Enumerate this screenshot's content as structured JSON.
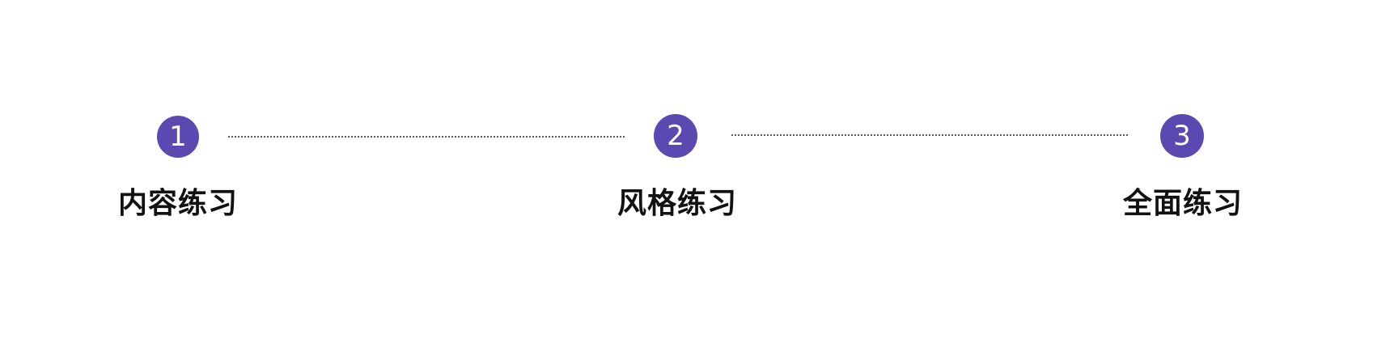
{
  "steps": [
    {
      "number": "1",
      "label": "内容练习"
    },
    {
      "number": "2",
      "label": "风格练习"
    },
    {
      "number": "3",
      "label": "全面练习"
    }
  ],
  "colors": {
    "accent": "#5b48b0",
    "connector": "#5a5a5a",
    "label_text": "#111111",
    "background": "#ffffff"
  }
}
